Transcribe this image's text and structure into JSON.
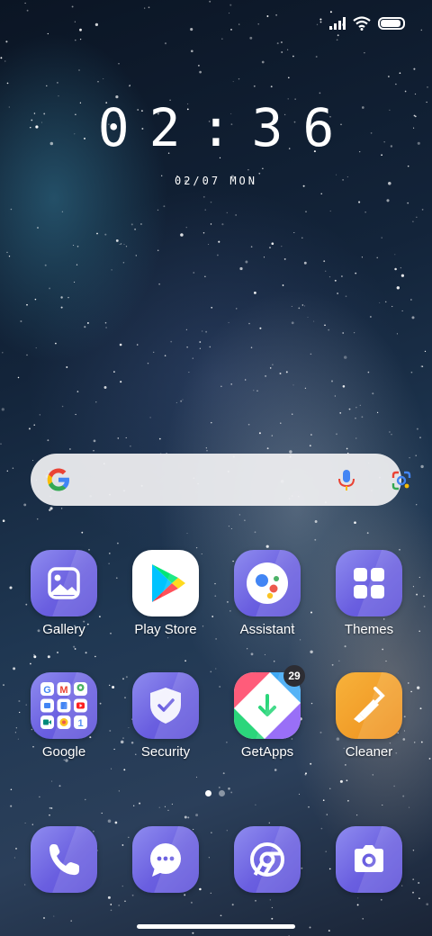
{
  "status_bar": {
    "signal_icon": "signal-bars-icon",
    "wifi_icon": "wifi-icon",
    "battery_icon": "battery-icon",
    "battery_level": 0.9
  },
  "clock": {
    "time": "02:36",
    "date": "02/07 MON"
  },
  "search_bar": {
    "logo": "google-g-icon",
    "voice_icon": "microphone-icon",
    "lens_icon": "google-lens-icon"
  },
  "apps": [
    {
      "label": "Gallery",
      "icon": "gallery-icon"
    },
    {
      "label": "Play Store",
      "icon": "play-store-icon"
    },
    {
      "label": "Assistant",
      "icon": "assistant-icon"
    },
    {
      "label": "Themes",
      "icon": "themes-icon"
    },
    {
      "label": "Google",
      "icon": "google-folder-icon"
    },
    {
      "label": "Security",
      "icon": "security-shield-icon"
    },
    {
      "label": "GetApps",
      "icon": "getapps-icon",
      "badge": "29"
    },
    {
      "label": "Cleaner",
      "icon": "cleaner-brush-icon"
    }
  ],
  "page_indicator": {
    "pages": 2,
    "active": 1
  },
  "dock": [
    {
      "icon": "phone-icon"
    },
    {
      "icon": "messages-icon"
    },
    {
      "icon": "browser-icon"
    },
    {
      "icon": "camera-icon"
    }
  ],
  "colors": {
    "icon_tile": "#6a5fe0",
    "cleaner_tile": "#f2a22c",
    "badge": "#2d2d33"
  }
}
